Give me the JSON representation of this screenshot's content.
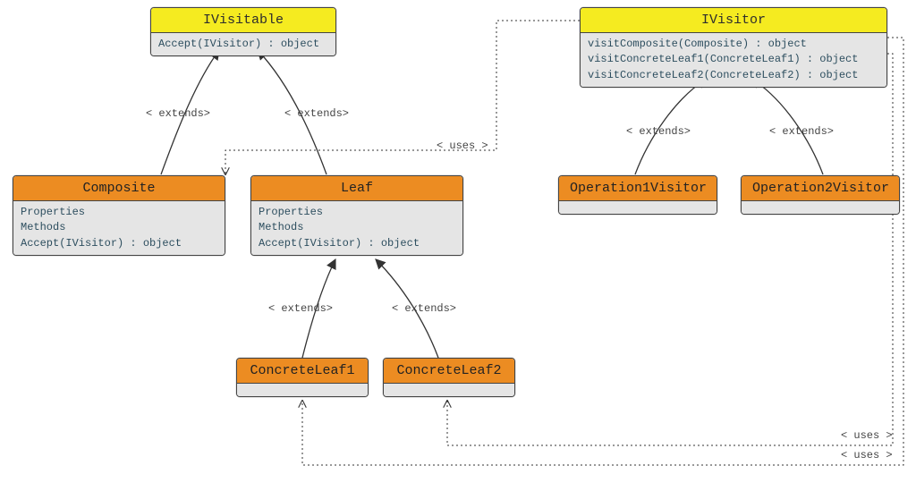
{
  "boxes": {
    "ivisitable": {
      "title": "IVisitable",
      "members": [
        "Accept(IVisitor) : object"
      ]
    },
    "ivisitor": {
      "title": "IVisitor",
      "members": [
        "visitComposite(Composite) : object",
        "visitConcreteLeaf1(ConcreteLeaf1) : object",
        "visitConcreteLeaf2(ConcreteLeaf2) : object"
      ]
    },
    "composite": {
      "title": "Composite",
      "members": [
        "Properties",
        "Methods",
        "Accept(IVisitor) : object"
      ]
    },
    "leaf": {
      "title": "Leaf",
      "members": [
        "Properties",
        "Methods",
        "Accept(IVisitor) : object"
      ]
    },
    "op1": {
      "title": "Operation1Visitor",
      "members": []
    },
    "op2": {
      "title": "Operation2Visitor",
      "members": []
    },
    "cleaf1": {
      "title": "ConcreteLeaf1",
      "members": []
    },
    "cleaf2": {
      "title": "ConcreteLeaf2",
      "members": []
    }
  },
  "labels": {
    "extends": "< extends>",
    "uses": "< uses >"
  },
  "chart_data": {
    "type": "uml-class-diagram",
    "classes": [
      {
        "name": "IVisitable",
        "stereotype": "interface",
        "members": [
          "Accept(IVisitor) : object"
        ]
      },
      {
        "name": "IVisitor",
        "stereotype": "interface",
        "members": [
          "visitComposite(Composite) : object",
          "visitConcreteLeaf1(ConcreteLeaf1) : object",
          "visitConcreteLeaf2(ConcreteLeaf2) : object"
        ]
      },
      {
        "name": "Composite",
        "members": [
          "Properties",
          "Methods",
          "Accept(IVisitor) : object"
        ]
      },
      {
        "name": "Leaf",
        "members": [
          "Properties",
          "Methods",
          "Accept(IVisitor) : object"
        ]
      },
      {
        "name": "Operation1Visitor",
        "members": []
      },
      {
        "name": "Operation2Visitor",
        "members": []
      },
      {
        "name": "ConcreteLeaf1",
        "members": []
      },
      {
        "name": "ConcreteLeaf2",
        "members": []
      }
    ],
    "relations": [
      {
        "from": "Composite",
        "to": "IVisitable",
        "type": "extends"
      },
      {
        "from": "Leaf",
        "to": "IVisitable",
        "type": "extends"
      },
      {
        "from": "ConcreteLeaf1",
        "to": "Leaf",
        "type": "extends"
      },
      {
        "from": "ConcreteLeaf2",
        "to": "Leaf",
        "type": "extends"
      },
      {
        "from": "Operation1Visitor",
        "to": "IVisitor",
        "type": "extends"
      },
      {
        "from": "Operation2Visitor",
        "to": "IVisitor",
        "type": "extends"
      },
      {
        "from": "IVisitor",
        "to": "Composite",
        "type": "uses"
      },
      {
        "from": "IVisitor",
        "to": "ConcreteLeaf1",
        "type": "uses"
      },
      {
        "from": "IVisitor",
        "to": "ConcreteLeaf2",
        "type": "uses"
      }
    ]
  }
}
